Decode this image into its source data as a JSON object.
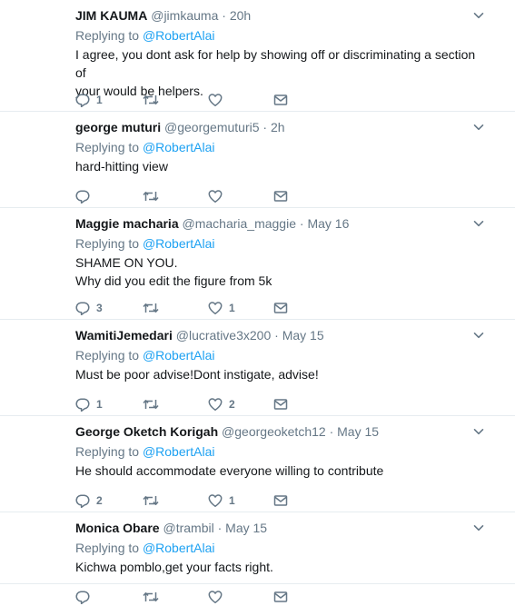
{
  "tweets": [
    {
      "name": "JIM KAUMA",
      "handle": "@jimkauma",
      "dot": "·",
      "time": "20h",
      "replying_prefix": "Replying to",
      "replying_to": "@RobertAlai",
      "lines": [
        "I agree, you dont ask for help by showing off or discriminating a section of",
        "your would be helpers."
      ],
      "reply_count": "1",
      "retweet_count": "",
      "like_count": ""
    },
    {
      "name": "george muturi",
      "handle": "@georgemuturi5",
      "dot": "·",
      "time": "2h",
      "replying_prefix": "Replying to",
      "replying_to": "@RobertAlai",
      "lines": [
        "hard-hitting view"
      ],
      "reply_count": "",
      "retweet_count": "",
      "like_count": ""
    },
    {
      "name": "Maggie macharia",
      "handle": "@macharia_maggie",
      "dot": "·",
      "time": "May 16",
      "replying_prefix": "Replying to",
      "replying_to": "@RobertAlai",
      "lines": [
        "SHAME ON YOU.",
        "Why did you edit the figure from 5k"
      ],
      "reply_count": "3",
      "retweet_count": "",
      "like_count": "1"
    },
    {
      "name": "WamitiJemedari",
      "handle": "@lucrative3x200",
      "dot": "·",
      "time": "May 15",
      "replying_prefix": "Replying to",
      "replying_to": "@RobertAlai",
      "lines": [
        "Must be poor advise!Dont instigate, advise!"
      ],
      "reply_count": "1",
      "retweet_count": "",
      "like_count": "2"
    },
    {
      "name": "George Oketch Korigah",
      "handle": "@georgeoketch12",
      "dot": "·",
      "time": "May 15",
      "replying_prefix": "Replying to",
      "replying_to": "@RobertAlai",
      "lines": [
        "He should accommodate everyone willing to contribute"
      ],
      "reply_count": "2",
      "retweet_count": "",
      "like_count": "1"
    },
    {
      "name": "Monica Obare",
      "handle": "@trambil",
      "dot": "·",
      "time": "May 15",
      "replying_prefix": "Replying to",
      "replying_to": "@RobertAlai",
      "lines": [
        "Kichwa pomblo,get your facts right."
      ],
      "reply_count": "",
      "retweet_count": "",
      "like_count": ""
    }
  ],
  "colors": {
    "link": "#1da1f2",
    "muted": "#657786",
    "divider": "#e6ecf0",
    "text": "#14171a"
  },
  "icons": [
    "reply-icon",
    "retweet-icon",
    "like-icon",
    "direct-message-icon",
    "chevron-down-icon"
  ]
}
